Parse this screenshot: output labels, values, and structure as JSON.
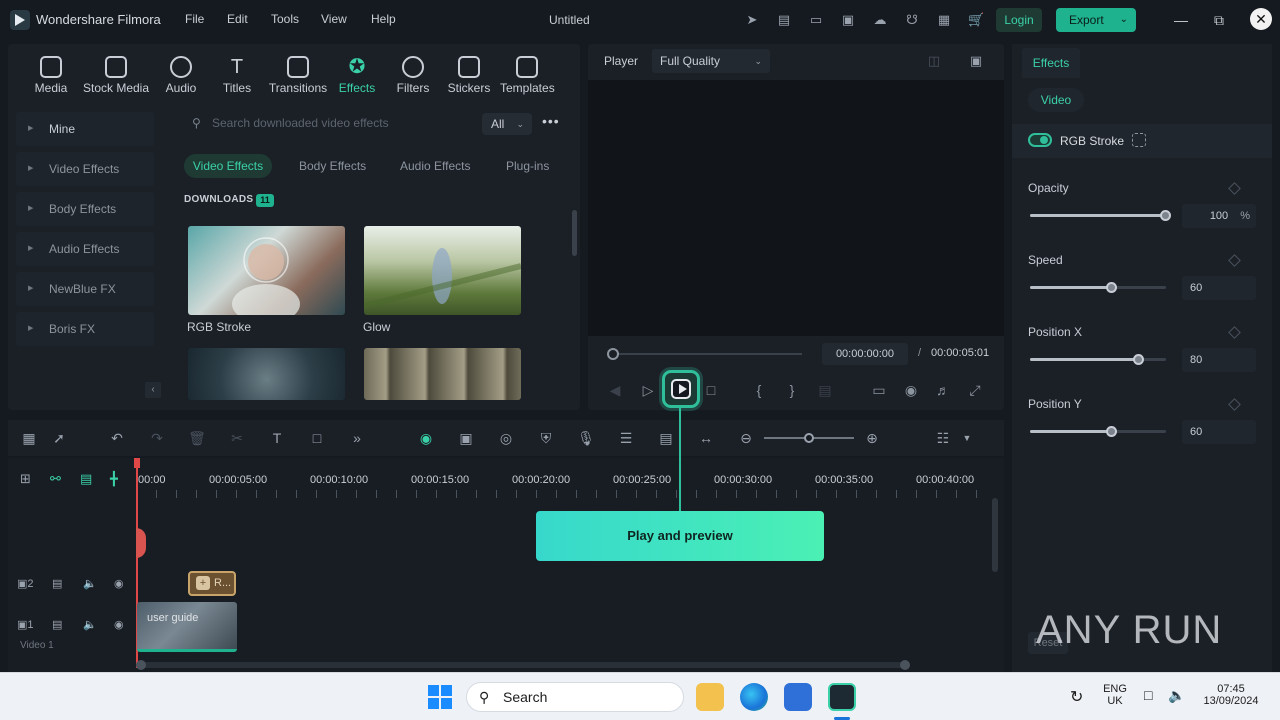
{
  "titlebar": {
    "app_name": "Wondershare Filmora",
    "menu": [
      "File",
      "Edit",
      "Tools",
      "View",
      "Help"
    ],
    "doc_title": "Untitled",
    "login_label": "Login",
    "export_label": "Export",
    "icons": [
      "send-icon",
      "cloud-save-icon",
      "layout-icon",
      "save-icon",
      "cloud-upload-icon",
      "headset-icon",
      "grid-icon",
      "cart-icon"
    ]
  },
  "media_tabs": [
    {
      "label": "Media",
      "icon": "media-icon"
    },
    {
      "label": "Stock Media",
      "icon": "stock-media-icon"
    },
    {
      "label": "Audio",
      "icon": "audio-icon"
    },
    {
      "label": "Titles",
      "icon": "titles-icon"
    },
    {
      "label": "Transitions",
      "icon": "transitions-icon"
    },
    {
      "label": "Effects",
      "icon": "effects-icon",
      "active": true
    },
    {
      "label": "Filters",
      "icon": "filters-icon"
    },
    {
      "label": "Stickers",
      "icon": "stickers-icon"
    },
    {
      "label": "Templates",
      "icon": "templates-icon"
    }
  ],
  "sidebar": {
    "items": [
      "Mine",
      "Video Effects",
      "Body Effects",
      "Audio Effects",
      "NewBlue FX",
      "Boris FX"
    ]
  },
  "search": {
    "placeholder": "Search downloaded video effects",
    "filter_value": "All"
  },
  "effect_tabs": [
    "Video Effects",
    "Body Effects",
    "Audio Effects",
    "Plug-ins"
  ],
  "downloads": {
    "label": "DOWNLOADS",
    "count": "11",
    "items": [
      {
        "label": "RGB Stroke"
      },
      {
        "label": "Glow"
      },
      {
        "label": ""
      },
      {
        "label": ""
      }
    ]
  },
  "player": {
    "label": "Player",
    "quality": "Full Quality",
    "time_current": "00:00:00:00",
    "time_separator": "/",
    "time_total": "00:00:05:01"
  },
  "properties": {
    "tab": "Effects",
    "subtab": "Video",
    "effect_name": "RGB Stroke",
    "effect_enabled": true,
    "params": [
      {
        "label": "Opacity",
        "value": "100",
        "unit": "%",
        "fraction": 1.0
      },
      {
        "label": "Speed",
        "value": "60",
        "unit": "",
        "fraction": 0.6
      },
      {
        "label": "Position X",
        "value": "80",
        "unit": "",
        "fraction": 0.8
      },
      {
        "label": "Position Y",
        "value": "60",
        "unit": "",
        "fraction": 0.6
      }
    ],
    "reset_label": "Reset"
  },
  "timeline": {
    "ruler": [
      "00:00",
      "00:00:05:00",
      "00:00:10:00",
      "00:00:15:00",
      "00:00:20:00",
      "00:00:25:00",
      "00:00:30:00",
      "00:00:35:00",
      "00:00:40:00"
    ],
    "tooltip": "Play and preview",
    "tracks": [
      {
        "number": "2",
        "clip": "R..."
      },
      {
        "number": "1",
        "clip": "user guide",
        "name": "Video 1"
      }
    ]
  },
  "watermark": "ANY RUN",
  "taskbar": {
    "search_label": "Search",
    "lang_top": "ENG",
    "lang_bottom": "UK",
    "time": "07:45",
    "date": "13/09/2024"
  },
  "colors": {
    "accent": "#3ad1a8",
    "background": "#151a20",
    "panel": "#1b2027",
    "playhead": "#e04848"
  }
}
